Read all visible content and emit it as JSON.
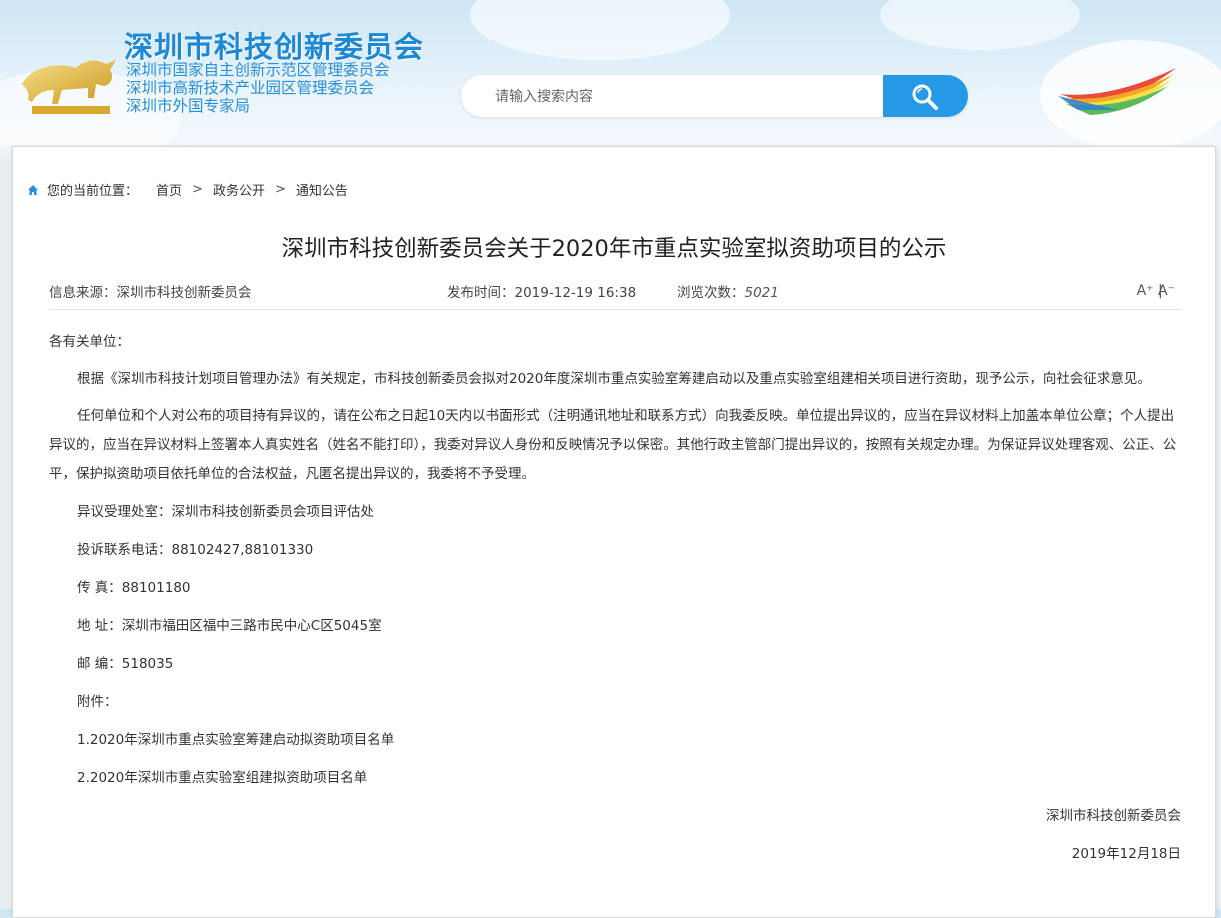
{
  "header": {
    "title": "深圳市科技创新委员会",
    "subtitles": [
      "深圳市国家自主创新示范区管理委员会",
      "深圳市高新技术产业园区管理委员会",
      "深圳市外国专家局"
    ],
    "search_placeholder": "请输入搜索内容"
  },
  "breadcrumb": {
    "label": "您的当前位置：",
    "items": [
      "首页",
      "政务公开",
      "通知公告"
    ],
    "separator": ">"
  },
  "article": {
    "title": "深圳市科技创新委员会关于2020年市重点实验室拟资助项目的公示",
    "meta": {
      "source_label": "信息来源：",
      "source": "深圳市科技创新委员会",
      "time_label": "发布时间：",
      "time": "2019-12-19 16:38",
      "views_label": "浏览次数：",
      "views": "5021",
      "font_increase": "A⁺",
      "font_divider": "|",
      "font_decrease": "A⁻"
    },
    "salutation": "各有关单位：",
    "para1": "根据《深圳市科技计划项目管理办法》有关规定，市科技创新委员会拟对2020年度深圳市重点实验室筹建启动以及重点实验室组建相关项目进行资助，现予公示，向社会征求意见。",
    "para2": "任何单位和个人对公布的项目持有异议的，请在公布之日起10天内以书面形式（注明通讯地址和联系方式）向我委反映。单位提出异议的，应当在异议材料上加盖本单位公章；个人提出异议的，应当在异议材料上签署本人真实姓名（姓名不能打印），我委对异议人身份和反映情况予以保密。其他行政主管部门提出异议的，按照有关规定办理。为保证异议处理客观、公正、公平，保护拟资助项目依托单位的合法权益，凡匿名提出异议的，我委将不予受理。",
    "office": "异议受理处室：深圳市科技创新委员会项目评估处",
    "phone": "投诉联系电话：88102427,88101330",
    "fax": "传 真：88101180",
    "address": "地 址：深圳市福田区福中三路市民中心C区5045室",
    "postcode": "邮 编：518035",
    "attachments_label": "附件：",
    "attachments": [
      "1.2020年深圳市重点实验室筹建启动拟资助项目名单",
      "2.2020年深圳市重点实验室组建拟资助项目名单"
    ],
    "signature": "深圳市科技创新委员会",
    "date": "2019年12月18日"
  }
}
